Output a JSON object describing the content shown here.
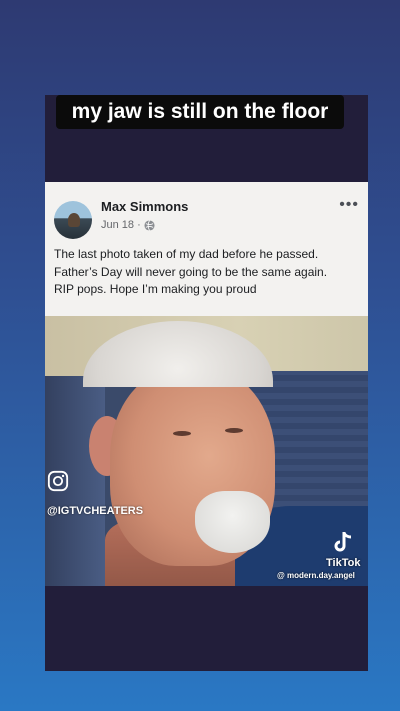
{
  "story": {
    "caption": "my jaw is still on the floor"
  },
  "post": {
    "author": "Max Simmons",
    "date": "Jun 18 ·",
    "more_icon": "more-options-icon",
    "text_lines": [
      "The last photo taken of my dad before he passed.",
      "Father’s Day will never going to be the same again.",
      "RIP pops. Hope I’m making you proud"
    ]
  },
  "watermarks": {
    "instagram_handle": "@IGTVCHEATERS",
    "tiktok_label": "TikTok",
    "tiktok_handle": "@ modern.day.angel"
  },
  "colors": {
    "background_top": "#2e3a72",
    "background_bottom": "#2a78c4",
    "frame": "#221e3a",
    "card": "#f3f2f0"
  }
}
